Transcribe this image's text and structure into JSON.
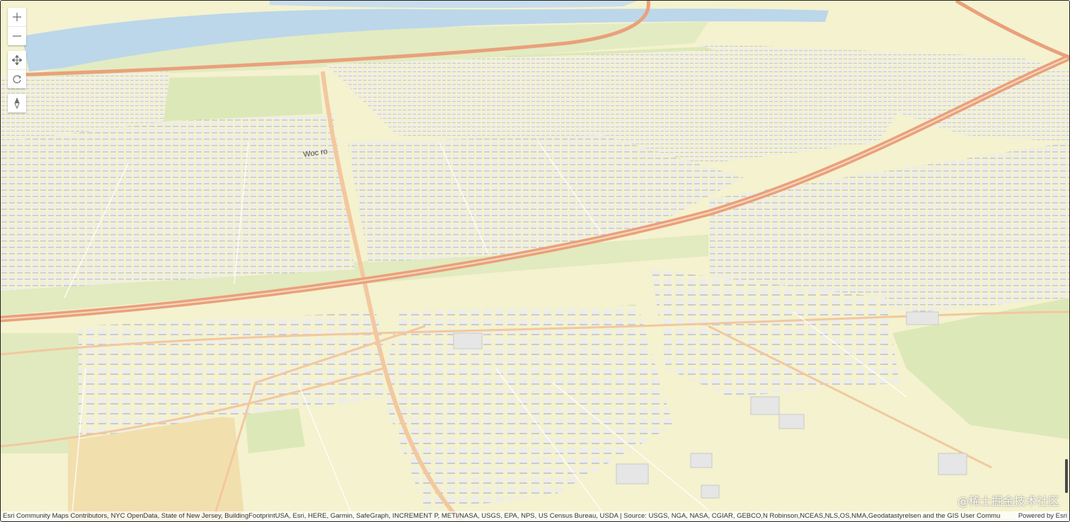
{
  "map": {
    "colors": {
      "land": "#f4f2cf",
      "park": "#dde8b8",
      "water": "#bcd7ea",
      "highway": "#e9a17b",
      "major_road": "#f2c89e",
      "building": "#e8e8e8",
      "building_shadow": "#c9c9c9",
      "field": "#f2dfae"
    },
    "street_labels": [
      "Woc ro"
    ]
  },
  "controls": {
    "zoom_in_icon": "plus-icon",
    "zoom_out_icon": "minus-icon",
    "pan_icon": "move-icon",
    "rotate_icon": "rotate-icon",
    "compass_icon": "compass-icon"
  },
  "attribution": {
    "text": "Esri Community Maps Contributors, NYC OpenData, State of New Jersey, BuildingFootprintUSA, Esri, HERE, Garmin, SafeGraph, INCREMENT P, METI/NASA, USGS, EPA, NPS, US Census Bureau, USDA | Source: USGS, NGA, NASA, CGIAR, GEBCO,N Robinson,NCEAS,NLS,OS,NMA,Geodatastyrelsen and the GIS User Community",
    "powered_by": "Powered by Esri"
  },
  "watermark": "@稀土掘金技术社区"
}
